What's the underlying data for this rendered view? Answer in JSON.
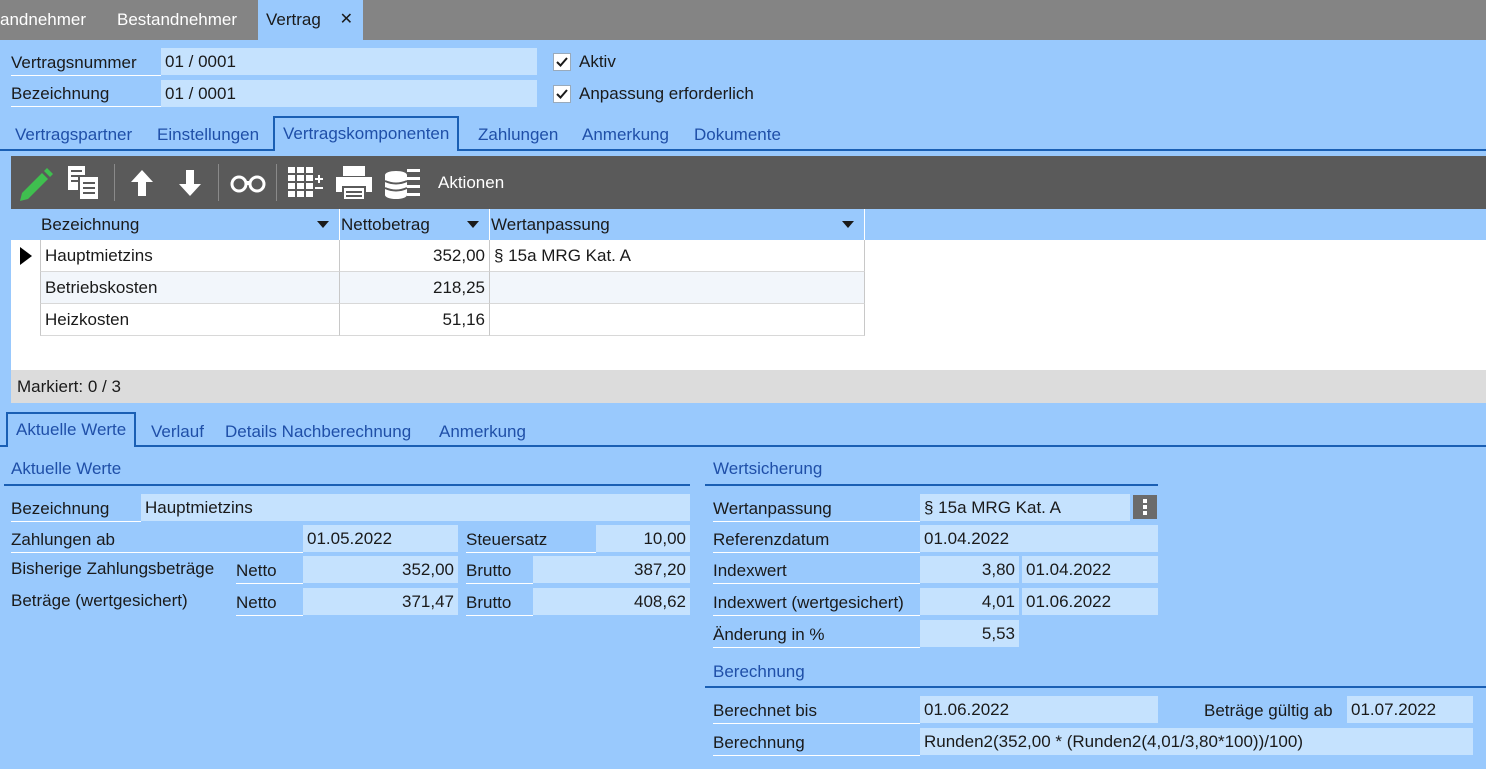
{
  "doc_tabs": [
    {
      "label": "andnehmer"
    },
    {
      "label": "Bestandnehmer"
    },
    {
      "label": "Vertrag",
      "close": "✕"
    }
  ],
  "header": {
    "vertragsnummer_label": "Vertragsnummer",
    "vertragsnummer_value": "01 / 0001",
    "bezeichnung_label": "Bezeichnung",
    "bezeichnung_value": "01 / 0001",
    "aktiv_label": "Aktiv",
    "aktiv_checked": true,
    "anpassung_label": "Anpassung erforderlich",
    "anpassung_checked": true
  },
  "main_tabs": [
    {
      "label": "Vertragspartner"
    },
    {
      "label": "Einstellungen"
    },
    {
      "label": "Vertragskomponenten",
      "active": true
    },
    {
      "label": "Zahlungen"
    },
    {
      "label": "Anmerkung"
    },
    {
      "label": "Dokumente"
    }
  ],
  "toolbar": {
    "icons": [
      "edit-pencil-icon",
      "copy-icon",
      "move-up-icon",
      "move-down-icon",
      "binoculars-icon",
      "grid-add-icon",
      "print-icon",
      "database-transfer-icon"
    ],
    "actions_label": "Aktionen"
  },
  "grid": {
    "columns": [
      "Bezeichnung",
      "Nettobetrag",
      "Wertanpassung"
    ],
    "rows": [
      {
        "bezeichnung": "Hauptmietzins",
        "netto": "352,00",
        "wertanpassung": "§ 15a MRG Kat. A",
        "current": true
      },
      {
        "bezeichnung": "Betriebskosten",
        "netto": "218,25",
        "wertanpassung": ""
      },
      {
        "bezeichnung": "Heizkosten",
        "netto": "51,16",
        "wertanpassung": ""
      }
    ],
    "status": "Markiert: 0 / 3"
  },
  "detail_tabs": [
    {
      "label": "Aktuelle Werte",
      "active": true
    },
    {
      "label": "Verlauf"
    },
    {
      "label": "Details Nachberechnung"
    },
    {
      "label": "Anmerkung"
    }
  ],
  "aktuelle_werte": {
    "title": "Aktuelle Werte",
    "bezeichnung_label": "Bezeichnung",
    "bezeichnung_value": "Hauptmietzins",
    "zahlungen_ab_label": "Zahlungen ab",
    "zahlungen_ab_value": "01.05.2022",
    "steuersatz_label": "Steuersatz",
    "steuersatz_value": "10,00",
    "bisherige_label": "Bisherige Zahlungsbeträge",
    "bisherige_netto_label": "Netto",
    "bisherige_netto_value": "352,00",
    "bisherige_brutto_label": "Brutto",
    "bisherige_brutto_value": "387,20",
    "betraege_label": "Beträge (wertgesichert)",
    "betraege_netto_label": "Netto",
    "betraege_netto_value": "371,47",
    "betraege_brutto_label": "Brutto",
    "betraege_brutto_value": "408,62"
  },
  "wertsicherung": {
    "title": "Wertsicherung",
    "wertanpassung_label": "Wertanpassung",
    "wertanpassung_value": "§ 15a MRG Kat. A",
    "referenzdatum_label": "Referenzdatum",
    "referenzdatum_value": "01.04.2022",
    "indexwert_label": "Indexwert",
    "indexwert_value": "3,80",
    "indexwert_date": "01.04.2022",
    "indexwert_ws_label": "Indexwert (wertgesichert)",
    "indexwert_ws_value": "4,01",
    "indexwert_ws_date": "01.06.2022",
    "aenderung_label": "Änderung in %",
    "aenderung_value": "5,53"
  },
  "berechnung": {
    "title": "Berechnung",
    "berechnet_bis_label": "Berechnet bis",
    "berechnet_bis_value": "01.06.2022",
    "gueltig_ab_label": "Beträge gültig ab",
    "gueltig_ab_value": "01.07.2022",
    "berechnung_label": "Berechnung",
    "berechnung_value": "Runden2(352,00 * (Runden2(4,01/3,80*100))/100)"
  }
}
